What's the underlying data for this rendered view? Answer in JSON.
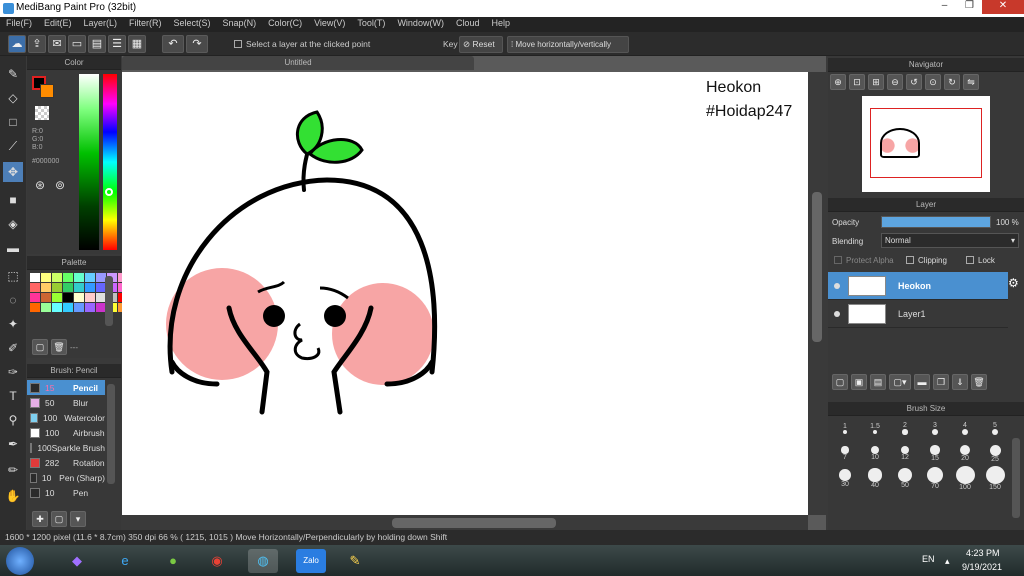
{
  "app": {
    "title": "MediBang Paint Pro (32bit)"
  },
  "menu": [
    "File(F)",
    "Edit(E)",
    "Layer(L)",
    "Filter(R)",
    "Select(S)",
    "Snap(N)",
    "Color(C)",
    "View(V)",
    "Tool(T)",
    "Window(W)",
    "Cloud",
    "Help"
  ],
  "toolbar": {
    "select_layer": "Select a layer at the clicked point",
    "key": "Key",
    "reset": "Reset",
    "move_hv": "Move horizontally/vertically"
  },
  "doc": {
    "tab": "Untitled"
  },
  "canvas": {
    "text1": "Heokon",
    "text2": "#Hoidap247"
  },
  "color": {
    "title": "Color",
    "r": "R:0",
    "g": "G:0",
    "b": "B:0",
    "hex": "#000000"
  },
  "palette": {
    "title": "Palette",
    "dashes": "---"
  },
  "brush": {
    "title": "Brush: Pencil",
    "items": [
      {
        "size": "15",
        "name": "Pencil",
        "color": "#2b2b2b"
      },
      {
        "size": "50",
        "name": "Blur",
        "color": "#e6b0e6"
      },
      {
        "size": "100",
        "name": "Watercolor",
        "color": "#7fd0f0"
      },
      {
        "size": "100",
        "name": "Airbrush",
        "color": "#ffffff"
      },
      {
        "size": "100",
        "name": "Sparkle Brush",
        "color": "#3b6fe0"
      },
      {
        "size": "282",
        "name": "Rotation",
        "color": "#e03a3a"
      },
      {
        "size": "10",
        "name": "Pen (Sharp)",
        "color": "#2b2b2b"
      },
      {
        "size": "10",
        "name": "Pen",
        "color": "#2b2b2b"
      }
    ]
  },
  "navigator": {
    "title": "Navigator"
  },
  "layer": {
    "title": "Layer",
    "opacity_label": "Opacity",
    "opacity_value": "100 %",
    "opacity": 1.0,
    "blending_label": "Blending",
    "blending_value": "Normal",
    "protect_alpha": "Protect Alpha",
    "clipping": "Clipping",
    "lock": "Lock",
    "layers": [
      {
        "name": "Heokon",
        "selected": true
      },
      {
        "name": "Layer1",
        "selected": false
      }
    ]
  },
  "brushsize": {
    "title": "Brush Size",
    "sizes": [
      "1",
      "1.5",
      "2",
      "3",
      "4",
      "5",
      "7",
      "10",
      "12",
      "15",
      "20",
      "25",
      "30",
      "40",
      "50",
      "70",
      "100",
      "150"
    ]
  },
  "status": {
    "text": "1600 * 1200 pixel   (11.6 * 8.7cm)   350 dpi   66 %   ( 1215, 1015 )   Move Horizontally/Perpendicularly by holding down Shift"
  },
  "taskbar": {
    "lang": "EN",
    "time": "4:23 PM",
    "date": "9/19/2021"
  },
  "colors": {
    "accent": "#4d8fd4",
    "selected_layer": "#4a90d0"
  }
}
